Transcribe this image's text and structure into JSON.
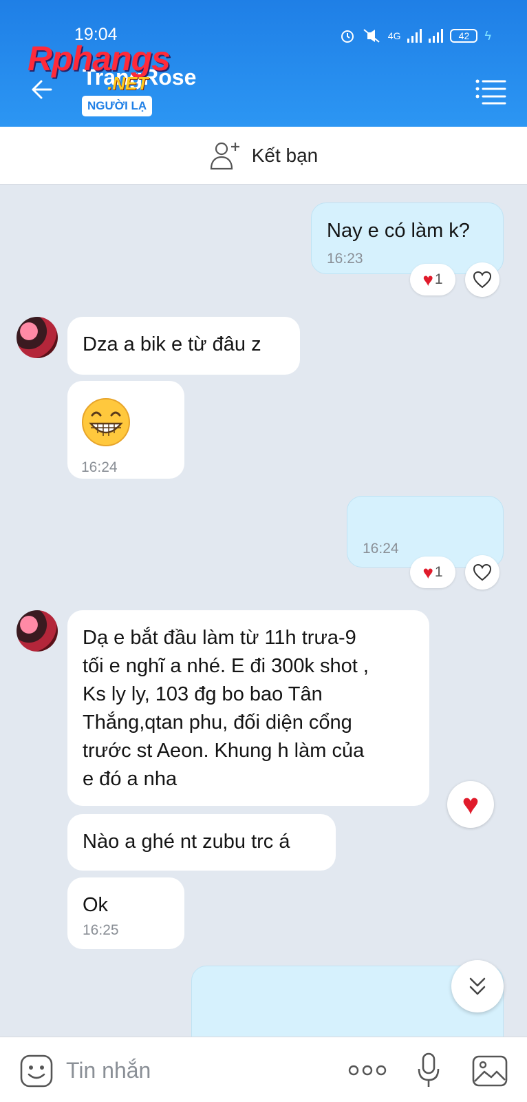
{
  "status_bar": {
    "time": "19:04",
    "network": "4G",
    "battery": "42"
  },
  "header": {
    "contact_name": "TrangRose",
    "badge": "NGƯỜI LẠ",
    "watermark": "Rphangs",
    "watermark_suffix": ".NET",
    "accent": "#1f7fe6"
  },
  "add_friend": {
    "label": "Kết bạn",
    "icon": "add-user-icon"
  },
  "messages": {
    "m1": {
      "text": "Nay e có làm k?",
      "time": "16:23",
      "reactions": "1"
    },
    "m2": {
      "text": "Dza a bik e từ đâu z"
    },
    "m3": {
      "sticker": "grinning-face-icon",
      "time": "16:24"
    },
    "m4": {
      "text": "",
      "time": "16:24",
      "reactions": "1"
    },
    "m5": {
      "lines": [
        "Dạ e  bắt đầu làm từ 11h trưa-9",
        "tối e nghĩ a nhé. E đi 300k shot ,",
        "Ks ly ly, 103 đg bo bao Tân",
        "Thắng,qtan phu, đối diện cổng",
        "trước st Aeon. Khung h làm của",
        "e đó a nha"
      ]
    },
    "m6": {
      "text": "Nào a ghé nt zubu trc á"
    },
    "m7": {
      "text": "Ok",
      "time": "16:25"
    }
  },
  "composer": {
    "placeholder": "Tin nhắn"
  },
  "colors": {
    "outgoing_bubble": "#d6f1fd",
    "incoming_bubble": "#ffffff",
    "background": "#e2e8f0",
    "heart": "#e01b2b"
  }
}
